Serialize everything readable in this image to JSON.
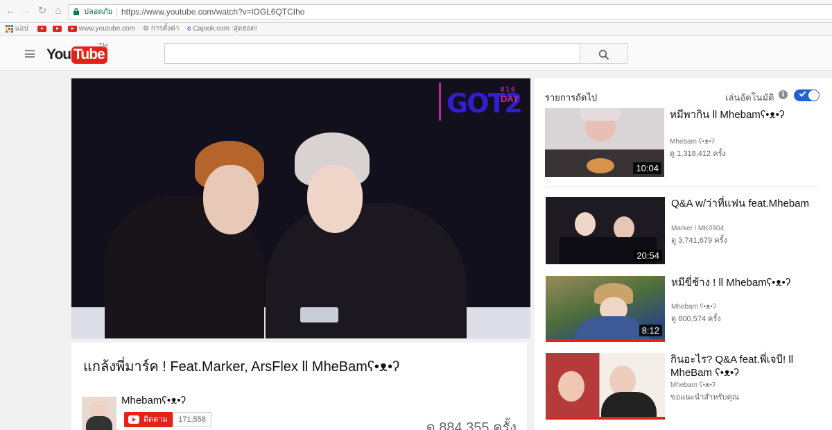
{
  "browser": {
    "secure_label": "ปลอดภัย",
    "url": "https://www.youtube.com/watch?v=lOGL6QTCIho",
    "bookmarks": [
      "แอป",
      "www.youtube.com",
      "การตั้งค่า",
      "Cajook.com :สุดฮอต!"
    ]
  },
  "header": {
    "logo_you": "You",
    "logo_tube": "Tube",
    "region": "TH",
    "search_placeholder": ""
  },
  "player": {
    "overlay_logo": "GOT2",
    "overlay_day": "DAY",
    "overlay_year": "016"
  },
  "video": {
    "title": "แกล้งพี่มาร์ค ! Feat.Marker, ArsFlex ll MheBamʕ•ᴥ•ʔ",
    "channel": "Mhebamʕ•ᴥ•ʔ",
    "subscribe_label": "ติดตาม",
    "subscriber_count": "171,558",
    "view_count": "ดู 884,355 ครั้ง"
  },
  "sidebar": {
    "up_next": "รายการถัดไป",
    "autoplay": "เล่นอัตโนมัติ",
    "autoplay_on": true,
    "items": [
      {
        "title": "หมีพากิน ll Mhebamʕ•ᴥ•ʔ",
        "channel": "Mhebam ʕ•ᴥ•ʔ",
        "views": "ดู 1,318,412 ครั้ง",
        "duration": "10:04",
        "watched": false
      },
      {
        "title": "Q&A w/ว่าที่แฟน feat.Mhebam",
        "channel": "Marker l MK0904",
        "views": "ดู 3,741,679 ครั้ง",
        "duration": "20:54",
        "watched": false
      },
      {
        "title": "หมีขี่ช้าง ! ll Mhebamʕ•ᴥ•ʔ",
        "channel": "Mhebam ʕ•ᴥ•ʔ",
        "views": "ดู 800,574 ครั้ง",
        "duration": "8:12",
        "watched": true
      },
      {
        "title": "กินอะไร? Q&A feat.พี่เจบี! ll MheBam ʕ•ᴥ•ʔ",
        "channel": "Mhebam ʕ•ᴥ•ʔ",
        "views": "ขอแนะนำสำหรับคุณ",
        "duration": "",
        "watched": true
      }
    ]
  },
  "colors": {
    "youtube_red": "#e62117",
    "toggle_blue": "#2560d0",
    "secure_green": "#0b8043"
  }
}
